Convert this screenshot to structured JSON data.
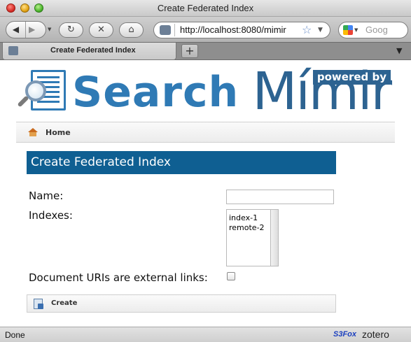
{
  "window": {
    "title": "Create Federated Index"
  },
  "toolbar": {
    "url": "http://localhost:8080/mimir",
    "search_placeholder": "Goog"
  },
  "tabs": [
    {
      "label": "Create Federated Index"
    }
  ],
  "newtab_label": "+",
  "brand": {
    "search_title": "Search",
    "powered_by": "powered by",
    "mimir": "Mímir"
  },
  "breadcrumb": {
    "home_label": "Home"
  },
  "form": {
    "heading": "Create Federated Index",
    "name_label": "Name:",
    "name_value": "",
    "indexes_label": "Indexes:",
    "indexes": [
      "index-1",
      "remote-2"
    ],
    "external_links_label": "Document URIs are external links:",
    "external_links_checked": false,
    "create_label": "Create"
  },
  "statusbar": {
    "status": "Done",
    "s3fox": "S3Fox",
    "zotero": "zotero"
  },
  "icons": {
    "back": "back-arrow-icon",
    "forward": "forward-arrow-icon",
    "reload": "reload-icon",
    "stop": "stop-icon",
    "home": "home-icon",
    "bookmark": "star-icon",
    "search_engine": "google-icon"
  }
}
